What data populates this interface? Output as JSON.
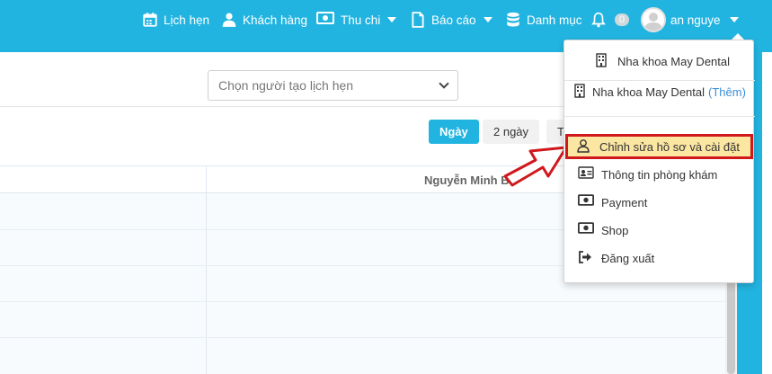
{
  "nav": {
    "appointments": "Lịch hẹn",
    "customers": "Khách hàng",
    "income_expense": "Thu chi",
    "reports": "Báo cáo",
    "catalog": "Danh mục",
    "notifications_count": "0",
    "user_name": "an nguye"
  },
  "filters": {
    "creator_select": "Chọn người tạo lịch hẹn"
  },
  "view_buttons": {
    "day": "Ngày",
    "two_days": "2 ngày",
    "more": "T"
  },
  "schedule": {
    "column_title": "Nguyễn Minh B"
  },
  "dropdown": {
    "clinic_current": "Nha khoa May Dental",
    "clinic_list_item": "Nha khoa May Dental",
    "clinic_add": "(Thêm)",
    "edit_profile": "Chỉnh sửa hồ sơ và cài đặt",
    "clinic_info": "Thông tin phòng khám",
    "payment": "Payment",
    "shop": "Shop",
    "logout": "Đăng xuất"
  },
  "colors": {
    "brand": "#22b4e0",
    "highlight_fill": "#fbe6a2",
    "highlight_border": "#d0181c",
    "arrow": "#d0181c",
    "link": "#3b8fd8"
  }
}
